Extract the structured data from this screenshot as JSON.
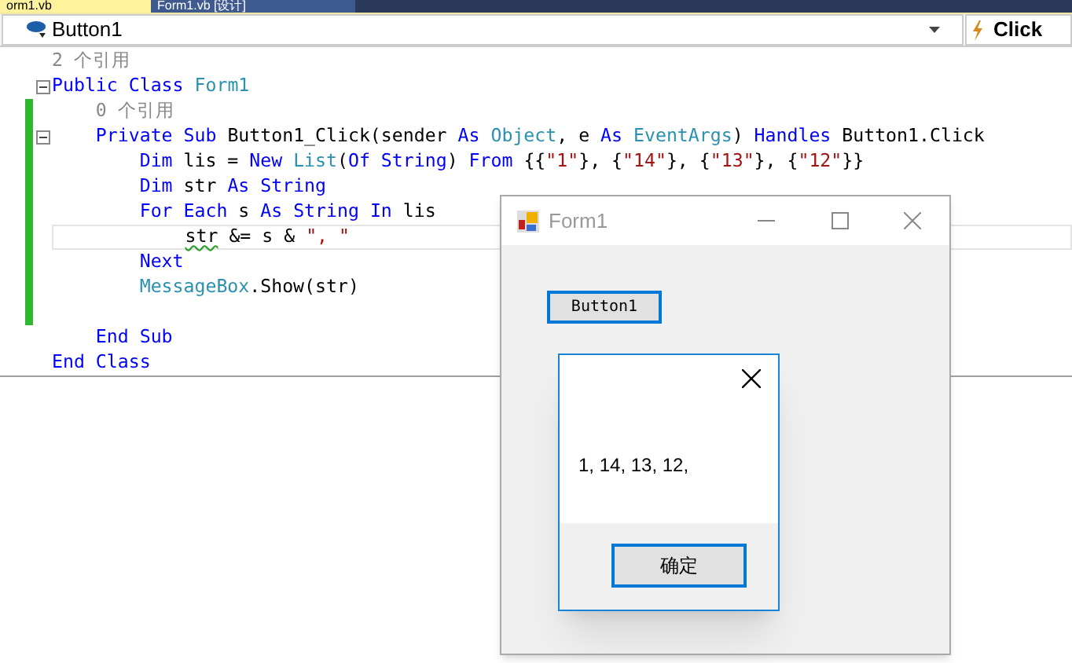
{
  "editor_tabs": [
    {
      "label": "orm1.vb",
      "selected": true
    },
    {
      "label": "Form1.vb [设计]",
      "selected": false
    }
  ],
  "navigation_bar": {
    "object": "Button1",
    "event": "Click"
  },
  "code_lines": [
    {
      "collapsible": false,
      "changed": false,
      "current": false,
      "tokens": [
        {
          "kind": "ref",
          "text": "2 个引用"
        }
      ]
    },
    {
      "collapsible": true,
      "changed": false,
      "current": false,
      "tokens": [
        {
          "kind": "keyword",
          "text": "Public Class "
        },
        {
          "kind": "type",
          "text": "Form1"
        }
      ]
    },
    {
      "collapsible": false,
      "changed": true,
      "current": false,
      "tokens": [
        {
          "kind": "ref",
          "text": "    0 个引用"
        }
      ]
    },
    {
      "collapsible": true,
      "changed": true,
      "current": false,
      "tokens": [
        {
          "kind": "keyword",
          "text": "    Private Sub "
        },
        {
          "kind": "plain",
          "text": "Button1_Click(sender "
        },
        {
          "kind": "keyword",
          "text": "As "
        },
        {
          "kind": "type",
          "text": "Object"
        },
        {
          "kind": "plain",
          "text": ", e "
        },
        {
          "kind": "keyword",
          "text": "As "
        },
        {
          "kind": "type",
          "text": "EventArgs"
        },
        {
          "kind": "plain",
          "text": ") "
        },
        {
          "kind": "keyword",
          "text": "Handles "
        },
        {
          "kind": "plain",
          "text": "Button1.Click"
        }
      ]
    },
    {
      "collapsible": false,
      "changed": true,
      "current": false,
      "tokens": [
        {
          "kind": "keyword",
          "text": "        Dim "
        },
        {
          "kind": "plain",
          "text": "lis = "
        },
        {
          "kind": "keyword",
          "text": "New "
        },
        {
          "kind": "type",
          "text": "List"
        },
        {
          "kind": "plain",
          "text": "("
        },
        {
          "kind": "keyword",
          "text": "Of String"
        },
        {
          "kind": "plain",
          "text": ") "
        },
        {
          "kind": "keyword",
          "text": "From "
        },
        {
          "kind": "plain",
          "text": "{{"
        },
        {
          "kind": "string",
          "text": "\"1\""
        },
        {
          "kind": "plain",
          "text": "}, {"
        },
        {
          "kind": "string",
          "text": "\"14\""
        },
        {
          "kind": "plain",
          "text": "}, {"
        },
        {
          "kind": "string",
          "text": "\"13\""
        },
        {
          "kind": "plain",
          "text": "}, {"
        },
        {
          "kind": "string",
          "text": "\"12\""
        },
        {
          "kind": "plain",
          "text": "}}"
        }
      ]
    },
    {
      "collapsible": false,
      "changed": true,
      "current": false,
      "tokens": [
        {
          "kind": "keyword",
          "text": "        Dim "
        },
        {
          "kind": "plain",
          "text": "str "
        },
        {
          "kind": "keyword",
          "text": "As String"
        }
      ]
    },
    {
      "collapsible": false,
      "changed": true,
      "current": false,
      "tokens": [
        {
          "kind": "keyword",
          "text": "        For Each "
        },
        {
          "kind": "plain",
          "text": "s "
        },
        {
          "kind": "keyword",
          "text": "As String In "
        },
        {
          "kind": "plain",
          "text": "lis"
        }
      ]
    },
    {
      "collapsible": false,
      "changed": true,
      "current": true,
      "tokens": [
        {
          "kind": "warning",
          "text": "            str"
        },
        {
          "kind": "plain",
          "text": " &= s & "
        },
        {
          "kind": "string",
          "text": "\", \""
        }
      ]
    },
    {
      "collapsible": false,
      "changed": true,
      "current": false,
      "tokens": [
        {
          "kind": "keyword",
          "text": "        Next"
        }
      ]
    },
    {
      "collapsible": false,
      "changed": true,
      "current": false,
      "tokens": [
        {
          "kind": "type",
          "text": "        MessageBox"
        },
        {
          "kind": "plain",
          "text": ".Show(str)"
        }
      ]
    },
    {
      "collapsible": false,
      "changed": true,
      "current": false
    },
    {
      "collapsible": false,
      "changed": false,
      "current": false,
      "tokens": [
        {
          "kind": "keyword",
          "text": "    End Sub"
        }
      ]
    },
    {
      "collapsible": false,
      "changed": false,
      "current": false,
      "tokens": [
        {
          "kind": "keyword",
          "text": "End Class"
        }
      ]
    }
  ],
  "form_window": {
    "title": "Form1",
    "active": false,
    "button": {
      "label": "Button1",
      "focused": true
    }
  },
  "message_box": {
    "text": "1, 14, 13, 12,",
    "button": {
      "label": "确定",
      "focused": true
    }
  }
}
